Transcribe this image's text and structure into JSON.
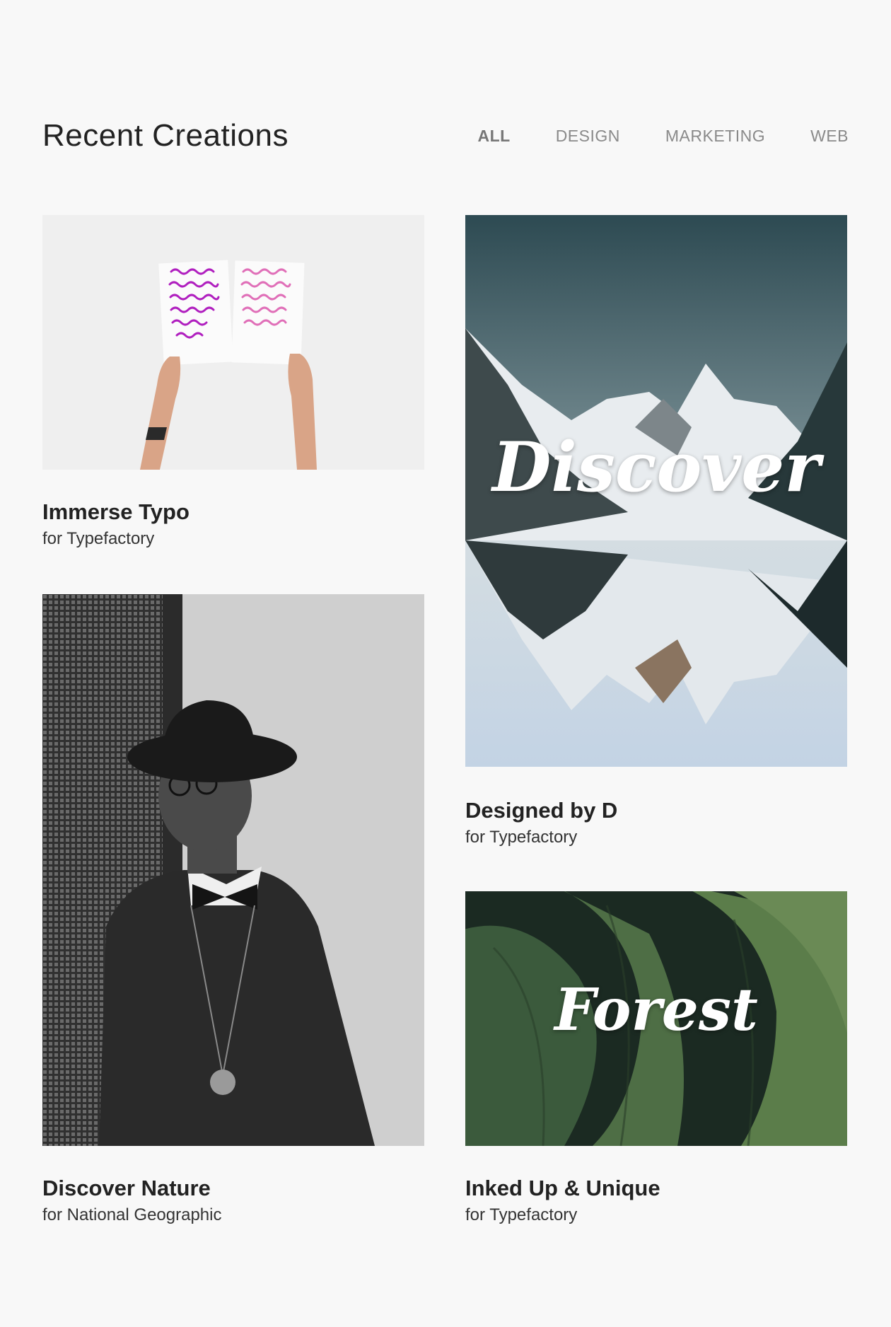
{
  "header": {
    "title": "Recent Creations",
    "filters": [
      {
        "label": "ALL",
        "active": true
      },
      {
        "label": "DESIGN",
        "active": false
      },
      {
        "label": "MARKETING",
        "active": false
      },
      {
        "label": "WEB",
        "active": false
      }
    ]
  },
  "projects": [
    {
      "title": "Immerse Typo",
      "client": "for Typefactory",
      "image": "hands holding typography alphabet sheets"
    },
    {
      "title": "Designed by D",
      "client": "for Typefactory",
      "image": "mountain lake reflection",
      "overlay_text": "Discover"
    },
    {
      "title": "Discover Nature",
      "client": "for National Geographic",
      "image": "black and white portrait of man in hat"
    },
    {
      "title": "Inked Up & Unique",
      "client": "for Typefactory",
      "image": "tropical leaves",
      "overlay_text": "Forest"
    }
  ],
  "colors": {
    "background": "#f8f8f8",
    "title": "#222222",
    "filter_inactive": "#8a8a8a",
    "filter_active": "#777777"
  }
}
